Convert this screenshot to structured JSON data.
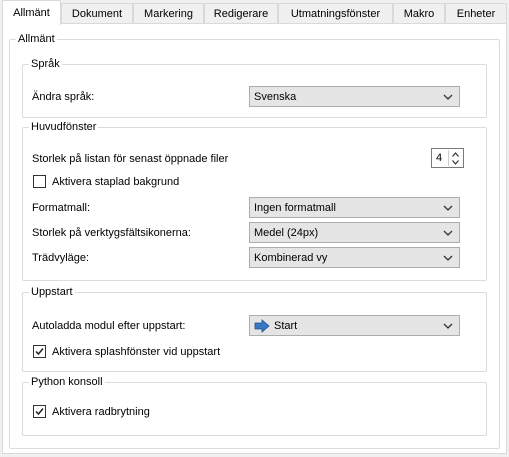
{
  "tabs": [
    "Allmänt",
    "Dokument",
    "Markering",
    "Redigerare",
    "Utmatningsfönster",
    "Makro",
    "Enheter"
  ],
  "panel_title": "Allmänt",
  "language": {
    "title": "Språk",
    "change_label": "Ändra språk:",
    "change_value": "Svenska"
  },
  "main_window": {
    "title": "Huvudfönster",
    "recent_label": "Storlek på listan för senast öppnade filer",
    "recent_value": "4",
    "stacked_bg_label": "Aktivera staplad bakgrund",
    "stacked_bg_checked": false,
    "style_label": "Formatmall:",
    "style_value": "Ingen formatmall",
    "toolbar_icon_label": "Storlek på verktygsfältsikonerna:",
    "toolbar_icon_value": "Medel (24px)",
    "tree_label": "Trädvyläge:",
    "tree_value": "Kombinerad vy"
  },
  "startup": {
    "title": "Uppstart",
    "autoload_label": "Autoladda modul efter uppstart:",
    "autoload_value": "Start",
    "splash_label": "Aktivera splashfönster vid uppstart",
    "splash_checked": true
  },
  "python_console": {
    "title": "Python konsoll",
    "wrap_label": "Aktivera radbrytning",
    "wrap_checked": true
  }
}
